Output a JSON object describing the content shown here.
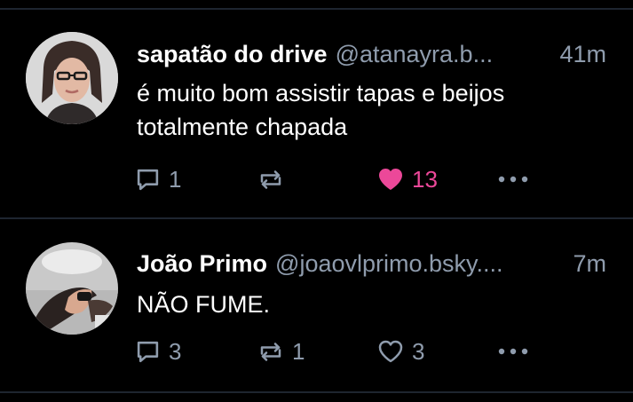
{
  "posts": [
    {
      "display_name": "sapatão do drive",
      "handle": "@atanayra.b...",
      "time": "41m",
      "text_lines": [
        "é muito bom assistir tapas e beijos",
        "totalmente chapada"
      ],
      "replies": "1",
      "reposts": "",
      "likes": "13",
      "liked": true,
      "icons": {
        "reply": "reply-icon",
        "repost": "repost-icon",
        "like": "heart-filled-icon",
        "more": "more-icon"
      }
    },
    {
      "display_name": "João Primo",
      "handle": "@joaovlprimo.bsky....",
      "time": "7m",
      "text_lines": [
        "NÃO FUME."
      ],
      "replies": "3",
      "reposts": "1",
      "likes": "3",
      "liked": false,
      "icons": {
        "reply": "reply-icon",
        "repost": "repost-icon",
        "like": "heart-outline-icon",
        "more": "more-icon"
      }
    }
  ],
  "colors": {
    "background": "#000000",
    "primary_text": "#ffffff",
    "secondary_text": "#8f9cad",
    "like_active": "#ec4899",
    "divider": "#1e2530"
  }
}
